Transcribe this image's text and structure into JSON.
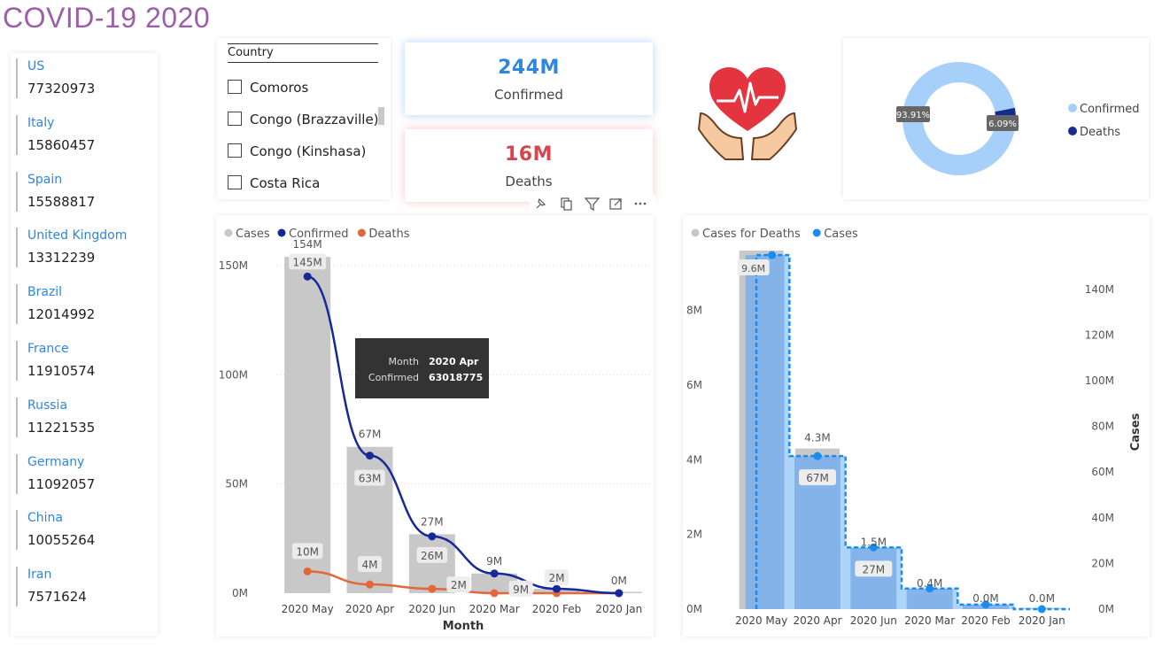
{
  "page": {
    "title": "COVID-19  2020"
  },
  "countries": [
    {
      "name": "US",
      "value": "77320973"
    },
    {
      "name": "Italy",
      "value": "15860457"
    },
    {
      "name": "Spain",
      "value": "15588817"
    },
    {
      "name": "United Kingdom",
      "value": "13312239"
    },
    {
      "name": "Brazil",
      "value": "12014992"
    },
    {
      "name": "France",
      "value": "11910574"
    },
    {
      "name": "Russia",
      "value": "11221535"
    },
    {
      "name": "Germany",
      "value": "11092057"
    },
    {
      "name": "China",
      "value": "10055264"
    },
    {
      "name": "Iran",
      "value": "7571624"
    }
  ],
  "slicer": {
    "title": "Country",
    "options": [
      "Comoros",
      "Congo (Brazzaville)",
      "Congo (Kinshasa)",
      "Costa Rica"
    ]
  },
  "kpis": {
    "confirmed": {
      "value": "244M",
      "label": "Confirmed",
      "color": "#2e86de"
    },
    "deaths": {
      "value": "16M",
      "label": "Deaths",
      "color": "#d64550"
    }
  },
  "icons": [
    "pin-icon",
    "copy-icon",
    "filter-icon",
    "focus-mode-icon",
    "more-options-icon",
    "heart-hands-icon"
  ],
  "chart_data": [
    {
      "type": "pie",
      "variant": "donut",
      "legend": "right",
      "slices": [
        {
          "name": "Confirmed",
          "value": 93.91,
          "label": "93.91%",
          "color": "#a6cffa"
        },
        {
          "name": "Deaths",
          "value": 6.09,
          "label": "6.09%",
          "color": "#142c8e"
        }
      ]
    },
    {
      "type": "bar",
      "subtype": "combo-bar-line",
      "legend": "top-left",
      "xlabel": "Month",
      "ylabel": "",
      "categories": [
        "2020 May",
        "2020 Apr",
        "2020 Jun",
        "2020 Mar",
        "2020 Feb",
        "2020 Jan"
      ],
      "ylim": [
        0,
        165000000
      ],
      "yticks": [
        0,
        50000000,
        100000000,
        150000000
      ],
      "ytick_labels": [
        "0M",
        "50M",
        "100M",
        "150M"
      ],
      "grid": true,
      "series": [
        {
          "name": "Cases",
          "kind": "bar",
          "color": "#c8c8c8",
          "values": [
            154000000,
            67000000,
            27000000,
            9000000,
            2000000,
            0
          ],
          "labels": [
            "154M",
            "67M",
            "27M",
            "9M",
            "2M",
            "0M"
          ]
        },
        {
          "name": "Confirmed",
          "kind": "line",
          "color": "#17289a",
          "values": [
            145000000,
            63000000,
            26000000,
            9000000,
            2000000,
            0
          ],
          "labels": [
            "145M",
            "63M",
            "26M",
            "9M",
            "2M",
            ""
          ]
        },
        {
          "name": "Deaths",
          "kind": "line",
          "color": "#e2673a",
          "values": [
            10000000,
            4000000,
            2000000,
            0,
            0,
            0
          ],
          "labels": [
            "10M",
            "4M",
            "2M",
            "",
            "",
            ""
          ]
        }
      ],
      "tooltip": {
        "rows": [
          {
            "key": "Month",
            "value": "2020 Apr"
          },
          {
            "key": "Confirmed",
            "value": "63018775"
          }
        ]
      }
    },
    {
      "type": "bar",
      "subtype": "combo-bar-step",
      "legend": "top-left",
      "xlabel": "",
      "ylabel": "",
      "y2label": "Cases",
      "categories": [
        "2020 May",
        "2020 Apr",
        "2020 Jun",
        "2020 Mar",
        "2020 Feb",
        "2020 Jan"
      ],
      "ylim": [
        0,
        9600000
      ],
      "yticks": [
        0,
        2000000,
        4000000,
        6000000,
        8000000
      ],
      "ytick_labels": [
        "0M",
        "2M",
        "4M",
        "6M",
        "8M"
      ],
      "y2lim": [
        0,
        157000000
      ],
      "y2ticks": [
        0,
        20000000,
        40000000,
        60000000,
        80000000,
        100000000,
        120000000,
        140000000
      ],
      "y2tick_labels": [
        "0M",
        "20M",
        "40M",
        "60M",
        "80M",
        "100M",
        "120M",
        "140M"
      ],
      "series": [
        {
          "name": "Cases for Deaths",
          "kind": "bar",
          "axis": "left",
          "color": "#c8c8c8",
          "values": [
            9600000,
            4300000,
            1500000,
            400000,
            0,
            0
          ],
          "labels": [
            "9.6M",
            "4.3M",
            "1.5M",
            "0.4M",
            "0.0M",
            "0.0M"
          ]
        },
        {
          "name": "Cases",
          "kind": "step",
          "axis": "right",
          "color": "#1a8cf0",
          "values": [
            155000000,
            67000000,
            27000000,
            9000000,
            2000000,
            0
          ],
          "labels": [
            "",
            "67M",
            "27M",
            "",
            "",
            ""
          ]
        }
      ]
    }
  ]
}
